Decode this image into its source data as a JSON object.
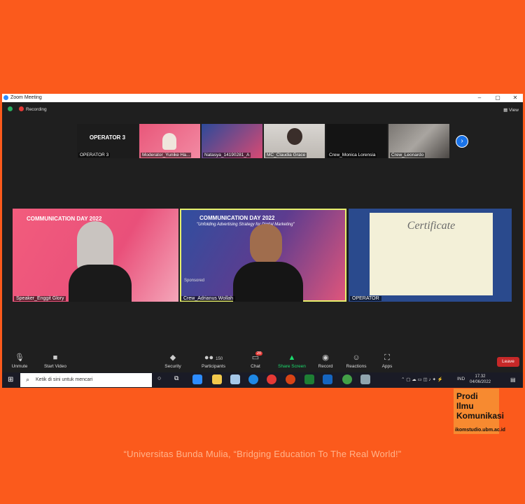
{
  "window": {
    "title": "Zoom Meeting",
    "min": "–",
    "max": "▢",
    "close": "✕"
  },
  "topbar": {
    "recording": "Recording",
    "view": "View"
  },
  "strip": [
    {
      "label": "OPERATOR 3",
      "big": "OPERATOR 3"
    },
    {
      "label": "Moderator_Yunike Ha..."
    },
    {
      "label": "Natasya_14190281_A"
    },
    {
      "label": "MC_Claudia Grace"
    },
    {
      "label": "Crew_Monica Lorensia"
    },
    {
      "label": "Crew_Leonardo"
    }
  ],
  "next": "›",
  "slide": {
    "title": "COMMUNICATION DAY 2022",
    "subtitle": "\"Unfolding Advertising Strategy for Digital Marketing\"",
    "sponsor": "Sponsored"
  },
  "tiles": [
    {
      "label": "Speaker_Enggit Glory"
    },
    {
      "label": "Crew_Adrianus Wollah"
    },
    {
      "label": "OPERATOR",
      "cert": "Certificate"
    }
  ],
  "controls": {
    "unmute": "Unmute",
    "start_video": "Start Video",
    "security": "Security",
    "participants": "Participants",
    "participants_count": "150",
    "chat": "Chat",
    "chat_badge": "20",
    "share": "Share Screen",
    "record": "Record",
    "reactions": "Reactions",
    "apps": "Apps",
    "leave": "Leave"
  },
  "taskbar": {
    "search_placeholder": "Ketik di sini untuk mencari",
    "lang": "IND",
    "time": "17.32",
    "date": "04/06/2022"
  },
  "badge": {
    "l1": "Prodi",
    "l2": "Ilmu",
    "l3": "Komunikasi",
    "site": "ikomstudio.ubm.ac.id"
  },
  "slogan": "“Universitas Bunda Mulia, “Bridging Education To The Real World!”",
  "colors": {
    "background": "#fb5a1c",
    "zoom_bg": "#1f1f1f",
    "share_green": "#1bdc6e",
    "leave_red": "#c62828",
    "active_border": "#e6f06b"
  }
}
